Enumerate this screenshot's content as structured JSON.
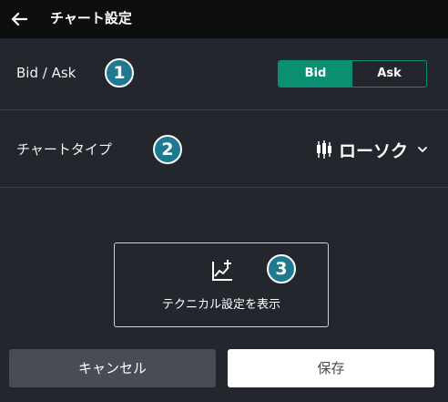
{
  "header": {
    "back_icon": "arrow-left-icon",
    "title": "チャート設定"
  },
  "bid_ask": {
    "label": "Bid / Ask",
    "badge": "1",
    "options": [
      "Bid",
      "Ask"
    ],
    "selected": "Bid",
    "accent_color": "#0a8f72"
  },
  "chart_type": {
    "label": "チャートタイプ",
    "badge": "2",
    "icon": "candlestick-icon",
    "value": "ローソク",
    "dropdown_icon": "chevron-down-icon"
  },
  "technical": {
    "icon": "chart-add-icon",
    "label": "テクニカル設定を表示",
    "badge": "3"
  },
  "footer": {
    "cancel_label": "キャンセル",
    "save_label": "保存"
  },
  "colors": {
    "background": "#23262d",
    "header": "#0d0e10",
    "badge": "#1f7a91"
  }
}
